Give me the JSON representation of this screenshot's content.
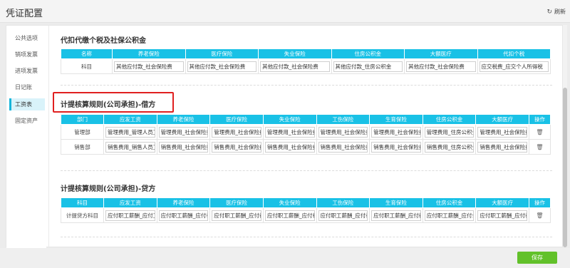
{
  "header": {
    "title": "凭证配置",
    "refresh_label": "刷新",
    "refresh_icon": "refresh-icon"
  },
  "sidebar": {
    "items": [
      {
        "label": "公共选项",
        "active": false
      },
      {
        "label": "销项发票",
        "active": false
      },
      {
        "label": "进项发票",
        "active": false
      },
      {
        "label": "日记账",
        "active": false
      },
      {
        "label": "工资表",
        "active": true
      },
      {
        "label": "固定资产",
        "active": false
      }
    ]
  },
  "sections": {
    "withholding": {
      "title": "代扣代缴个税及社保公积金",
      "headers": [
        "名称",
        "养老保险",
        "医疗保险",
        "失业保险",
        "住房公积金",
        "大额医疗",
        "代扣个税"
      ],
      "row": {
        "label": "科目",
        "values": [
          "其他应付款_社会保险费",
          "其他应付款_社会保险费",
          "其他应付款_社会保险费",
          "其他应付款_住房公积金",
          "其他应付款_社会保险费",
          "应交税费_应交个人所得税"
        ]
      }
    },
    "debit": {
      "title": "计提核算规则(公司承担)-借方",
      "headers": [
        "部门",
        "应发工资",
        "养老保险",
        "医疗保险",
        "失业保险",
        "工伤保险",
        "生育保险",
        "住房公积金",
        "大额医疗",
        "操作"
      ],
      "rows": [
        {
          "label": "管理部",
          "values": [
            "管理费用_管理人员工资",
            "管理费用_社会保险费",
            "管理费用_社会保险费",
            "管理费用_社会保险费",
            "管理费用_社会保险费",
            "管理费用_社会保险费",
            "管理费用_住房公积金",
            "管理费用_社会保险费"
          ]
        },
        {
          "label": "销售部",
          "values": [
            "销售费用_销售人员工资",
            "销售费用_社会保险费",
            "销售费用_社会保险费",
            "销售费用_社会保险费",
            "销售费用_社会保险费",
            "销售费用_社会保险费",
            "销售费用_住房公积金",
            "销售费用_社会保险费"
          ]
        }
      ]
    },
    "credit": {
      "title": "计提核算规则(公司承担)-贷方",
      "headers": [
        "科目",
        "应发工资",
        "养老保险",
        "医疗保险",
        "失业保险",
        "工伤保险",
        "生育保险",
        "住房公积金",
        "大额医疗",
        "操作"
      ],
      "row": {
        "label": "计提贷方科目",
        "values": [
          "应付职工薪酬_应付工资",
          "应付职工薪酬_应付社保",
          "应付职工薪酬_应付社保",
          "应付职工薪酬_应付社保",
          "应付职工薪酬_应付社保",
          "应付职工薪酬_应付社保",
          "应付职工薪酬_应付公积金",
          "应付职工薪酬_应付社保"
        ]
      }
    }
  },
  "footer": {
    "save_label": "保存"
  },
  "colors": {
    "header_cyan": "#19c1e6",
    "save_green": "#62c12a",
    "highlight_red": "#e02020",
    "active_nav": "#16b5d9"
  }
}
